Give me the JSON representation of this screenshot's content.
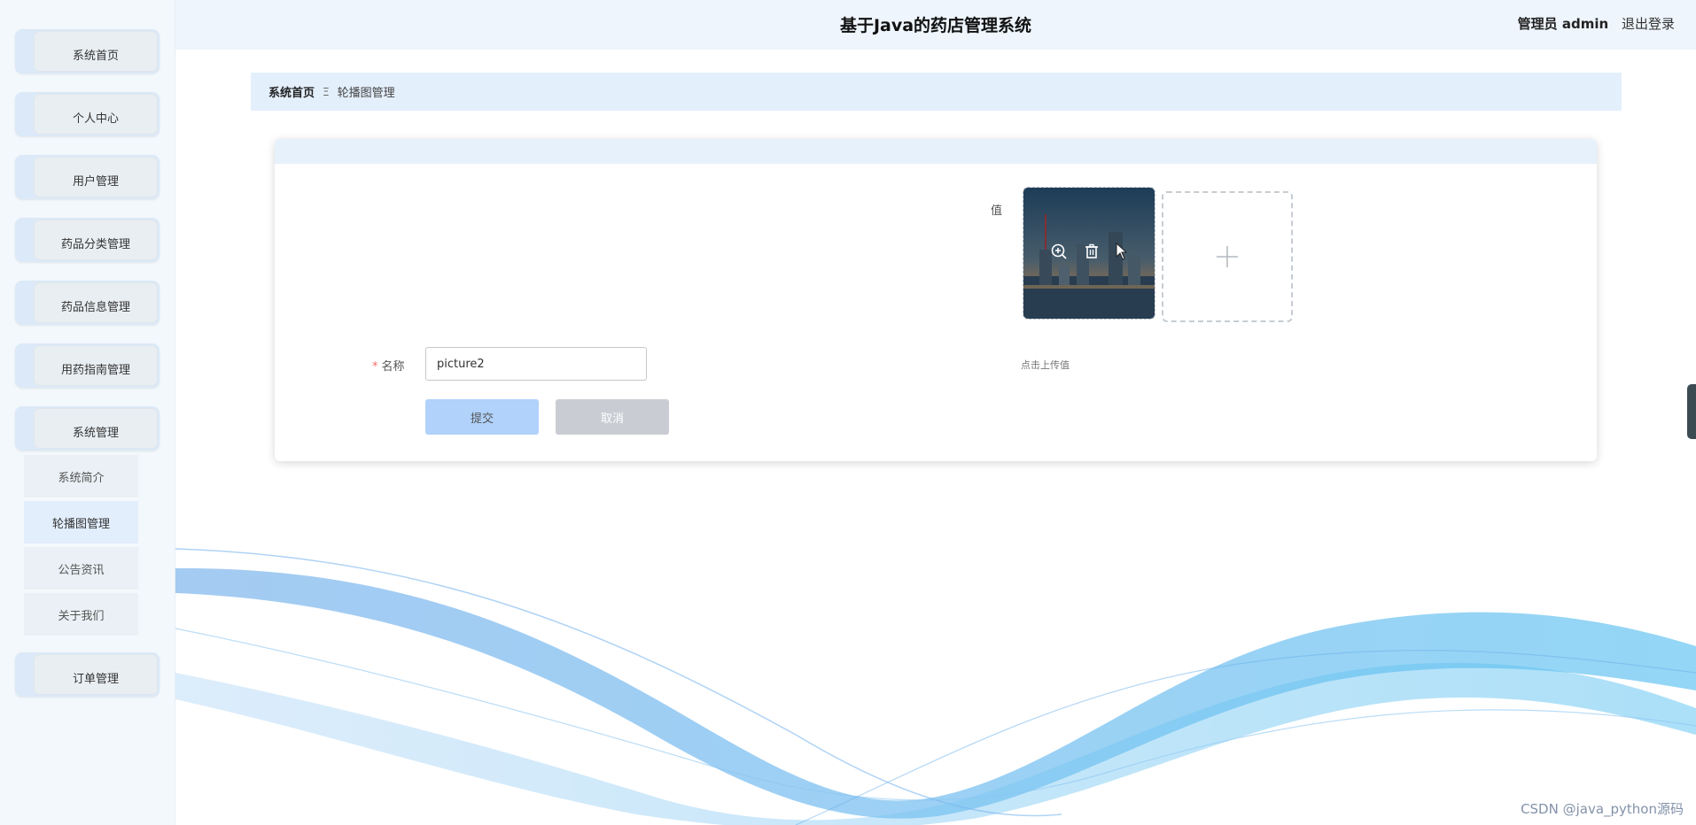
{
  "header": {
    "title": "基于Java的药店管理系统",
    "user_role": "管理员 admin",
    "logout": "退出登录"
  },
  "sidebar": {
    "items": [
      {
        "label": "系统首页"
      },
      {
        "label": "个人中心"
      },
      {
        "label": "用户管理"
      },
      {
        "label": "药品分类管理"
      },
      {
        "label": "药品信息管理"
      },
      {
        "label": "用药指南管理"
      },
      {
        "label": "系统管理"
      },
      {
        "label": "订单管理"
      }
    ],
    "submenu": [
      {
        "label": "系统简介"
      },
      {
        "label": "轮播图管理",
        "active": true
      },
      {
        "label": "公告资讯"
      },
      {
        "label": "关于我们"
      }
    ]
  },
  "breadcrumb": {
    "home": "系统首页",
    "separator": "Ξ",
    "current": "轮播图管理"
  },
  "form": {
    "value_label": "值",
    "name_label": "名称",
    "name_value": "picture2",
    "upload_tip": "点击上传值",
    "submit": "提交",
    "cancel": "取消"
  },
  "watermark": "CSDN @java_python源码",
  "colors": {
    "accent": "#b0d2fb",
    "header_bg": "#eef5fc",
    "breadcrumb_bg": "#e3effb",
    "required": "#f56c6c"
  }
}
